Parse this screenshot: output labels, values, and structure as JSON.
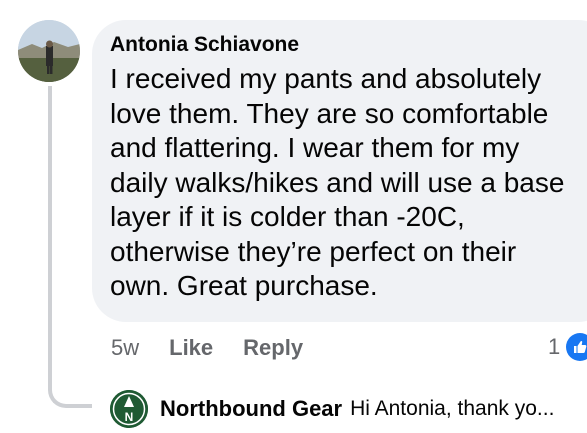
{
  "comment": {
    "author": "Antonia Schiavone",
    "text": "I received my pants and absolutely love them. They are so comfortable and flattering. I wear them for my daily walks/hikes and will use a base layer if it is colder than -20C, otherwise they’re perfect on their own. Great purchase.",
    "avatar_icon": "user-avatar-photo"
  },
  "actions": {
    "time": "5w",
    "like_label": "Like",
    "reply_label": "Reply"
  },
  "reactions": {
    "count": "1",
    "icon": "thumbs-up-icon",
    "color": "#1877f2"
  },
  "reply": {
    "author": "Northbound Gear",
    "preview": "Hi Antonia, thank yo...",
    "logo_icon": "brand-logo",
    "logo_letter": "N",
    "logo_color": "#1f5a33"
  }
}
